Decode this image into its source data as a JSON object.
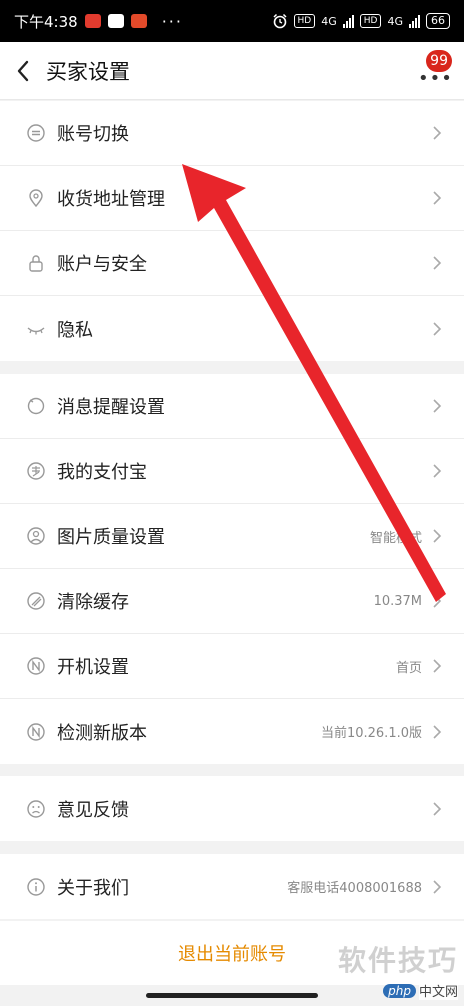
{
  "status_bar": {
    "time": "下午4:38",
    "more": "···",
    "hd": "HD",
    "net": "4G",
    "battery": "66"
  },
  "header": {
    "title": "买家设置",
    "badge": "99"
  },
  "groups": [
    {
      "items": [
        {
          "label": "账号切换",
          "value": "",
          "icon": "swap-icon"
        },
        {
          "label": "收货地址管理",
          "value": "",
          "icon": "location-pin-icon"
        },
        {
          "label": "账户与安全",
          "value": "",
          "icon": "lock-icon"
        },
        {
          "label": "隐私",
          "value": "",
          "icon": "eye-closed-icon"
        }
      ]
    },
    {
      "items": [
        {
          "label": "消息提醒设置",
          "value": "",
          "icon": "bell-icon"
        },
        {
          "label": "我的支付宝",
          "value": "",
          "icon": "alipay-icon"
        },
        {
          "label": "图片质量设置",
          "value": "智能模式",
          "icon": "image-quality-icon"
        },
        {
          "label": "清除缓存",
          "value": "10.37M",
          "icon": "broom-icon"
        },
        {
          "label": "开机设置",
          "value": "首页",
          "icon": "n-circle-icon"
        },
        {
          "label": "检测新版本",
          "value": "当前10.26.1.0版",
          "icon": "n-circle-icon"
        }
      ]
    },
    {
      "items": [
        {
          "label": "意见反馈",
          "value": "",
          "icon": "sad-face-icon"
        }
      ]
    },
    {
      "items": [
        {
          "label": "关于我们",
          "value": "客服电话4008001688",
          "icon": "info-icon"
        }
      ]
    }
  ],
  "logout": {
    "label": "退出当前账号"
  },
  "watermark": {
    "text": "软件技巧",
    "logo_php": "php",
    "logo_cn": "中文网"
  },
  "colors": {
    "accent": "#e58a00",
    "badge": "#d9261c",
    "arrow": "#e8252b"
  }
}
